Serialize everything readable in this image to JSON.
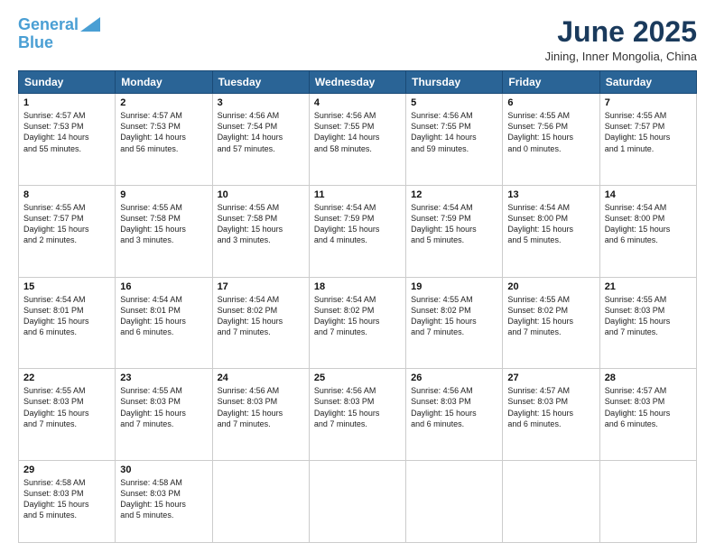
{
  "header": {
    "logo_line1": "General",
    "logo_line2": "Blue",
    "month": "June 2025",
    "location": "Jining, Inner Mongolia, China"
  },
  "weekdays": [
    "Sunday",
    "Monday",
    "Tuesday",
    "Wednesday",
    "Thursday",
    "Friday",
    "Saturday"
  ],
  "weeks": [
    [
      {
        "day": "1",
        "lines": [
          "Sunrise: 4:57 AM",
          "Sunset: 7:53 PM",
          "Daylight: 14 hours",
          "and 55 minutes."
        ]
      },
      {
        "day": "2",
        "lines": [
          "Sunrise: 4:57 AM",
          "Sunset: 7:53 PM",
          "Daylight: 14 hours",
          "and 56 minutes."
        ]
      },
      {
        "day": "3",
        "lines": [
          "Sunrise: 4:56 AM",
          "Sunset: 7:54 PM",
          "Daylight: 14 hours",
          "and 57 minutes."
        ]
      },
      {
        "day": "4",
        "lines": [
          "Sunrise: 4:56 AM",
          "Sunset: 7:55 PM",
          "Daylight: 14 hours",
          "and 58 minutes."
        ]
      },
      {
        "day": "5",
        "lines": [
          "Sunrise: 4:56 AM",
          "Sunset: 7:55 PM",
          "Daylight: 14 hours",
          "and 59 minutes."
        ]
      },
      {
        "day": "6",
        "lines": [
          "Sunrise: 4:55 AM",
          "Sunset: 7:56 PM",
          "Daylight: 15 hours",
          "and 0 minutes."
        ]
      },
      {
        "day": "7",
        "lines": [
          "Sunrise: 4:55 AM",
          "Sunset: 7:57 PM",
          "Daylight: 15 hours",
          "and 1 minute."
        ]
      }
    ],
    [
      {
        "day": "8",
        "lines": [
          "Sunrise: 4:55 AM",
          "Sunset: 7:57 PM",
          "Daylight: 15 hours",
          "and 2 minutes."
        ]
      },
      {
        "day": "9",
        "lines": [
          "Sunrise: 4:55 AM",
          "Sunset: 7:58 PM",
          "Daylight: 15 hours",
          "and 3 minutes."
        ]
      },
      {
        "day": "10",
        "lines": [
          "Sunrise: 4:55 AM",
          "Sunset: 7:58 PM",
          "Daylight: 15 hours",
          "and 3 minutes."
        ]
      },
      {
        "day": "11",
        "lines": [
          "Sunrise: 4:54 AM",
          "Sunset: 7:59 PM",
          "Daylight: 15 hours",
          "and 4 minutes."
        ]
      },
      {
        "day": "12",
        "lines": [
          "Sunrise: 4:54 AM",
          "Sunset: 7:59 PM",
          "Daylight: 15 hours",
          "and 5 minutes."
        ]
      },
      {
        "day": "13",
        "lines": [
          "Sunrise: 4:54 AM",
          "Sunset: 8:00 PM",
          "Daylight: 15 hours",
          "and 5 minutes."
        ]
      },
      {
        "day": "14",
        "lines": [
          "Sunrise: 4:54 AM",
          "Sunset: 8:00 PM",
          "Daylight: 15 hours",
          "and 6 minutes."
        ]
      }
    ],
    [
      {
        "day": "15",
        "lines": [
          "Sunrise: 4:54 AM",
          "Sunset: 8:01 PM",
          "Daylight: 15 hours",
          "and 6 minutes."
        ]
      },
      {
        "day": "16",
        "lines": [
          "Sunrise: 4:54 AM",
          "Sunset: 8:01 PM",
          "Daylight: 15 hours",
          "and 6 minutes."
        ]
      },
      {
        "day": "17",
        "lines": [
          "Sunrise: 4:54 AM",
          "Sunset: 8:02 PM",
          "Daylight: 15 hours",
          "and 7 minutes."
        ]
      },
      {
        "day": "18",
        "lines": [
          "Sunrise: 4:54 AM",
          "Sunset: 8:02 PM",
          "Daylight: 15 hours",
          "and 7 minutes."
        ]
      },
      {
        "day": "19",
        "lines": [
          "Sunrise: 4:55 AM",
          "Sunset: 8:02 PM",
          "Daylight: 15 hours",
          "and 7 minutes."
        ]
      },
      {
        "day": "20",
        "lines": [
          "Sunrise: 4:55 AM",
          "Sunset: 8:02 PM",
          "Daylight: 15 hours",
          "and 7 minutes."
        ]
      },
      {
        "day": "21",
        "lines": [
          "Sunrise: 4:55 AM",
          "Sunset: 8:03 PM",
          "Daylight: 15 hours",
          "and 7 minutes."
        ]
      }
    ],
    [
      {
        "day": "22",
        "lines": [
          "Sunrise: 4:55 AM",
          "Sunset: 8:03 PM",
          "Daylight: 15 hours",
          "and 7 minutes."
        ]
      },
      {
        "day": "23",
        "lines": [
          "Sunrise: 4:55 AM",
          "Sunset: 8:03 PM",
          "Daylight: 15 hours",
          "and 7 minutes."
        ]
      },
      {
        "day": "24",
        "lines": [
          "Sunrise: 4:56 AM",
          "Sunset: 8:03 PM",
          "Daylight: 15 hours",
          "and 7 minutes."
        ]
      },
      {
        "day": "25",
        "lines": [
          "Sunrise: 4:56 AM",
          "Sunset: 8:03 PM",
          "Daylight: 15 hours",
          "and 7 minutes."
        ]
      },
      {
        "day": "26",
        "lines": [
          "Sunrise: 4:56 AM",
          "Sunset: 8:03 PM",
          "Daylight: 15 hours",
          "and 6 minutes."
        ]
      },
      {
        "day": "27",
        "lines": [
          "Sunrise: 4:57 AM",
          "Sunset: 8:03 PM",
          "Daylight: 15 hours",
          "and 6 minutes."
        ]
      },
      {
        "day": "28",
        "lines": [
          "Sunrise: 4:57 AM",
          "Sunset: 8:03 PM",
          "Daylight: 15 hours",
          "and 6 minutes."
        ]
      }
    ],
    [
      {
        "day": "29",
        "lines": [
          "Sunrise: 4:58 AM",
          "Sunset: 8:03 PM",
          "Daylight: 15 hours",
          "and 5 minutes."
        ]
      },
      {
        "day": "30",
        "lines": [
          "Sunrise: 4:58 AM",
          "Sunset: 8:03 PM",
          "Daylight: 15 hours",
          "and 5 minutes."
        ]
      },
      {
        "day": "",
        "lines": []
      },
      {
        "day": "",
        "lines": []
      },
      {
        "day": "",
        "lines": []
      },
      {
        "day": "",
        "lines": []
      },
      {
        "day": "",
        "lines": []
      }
    ]
  ]
}
